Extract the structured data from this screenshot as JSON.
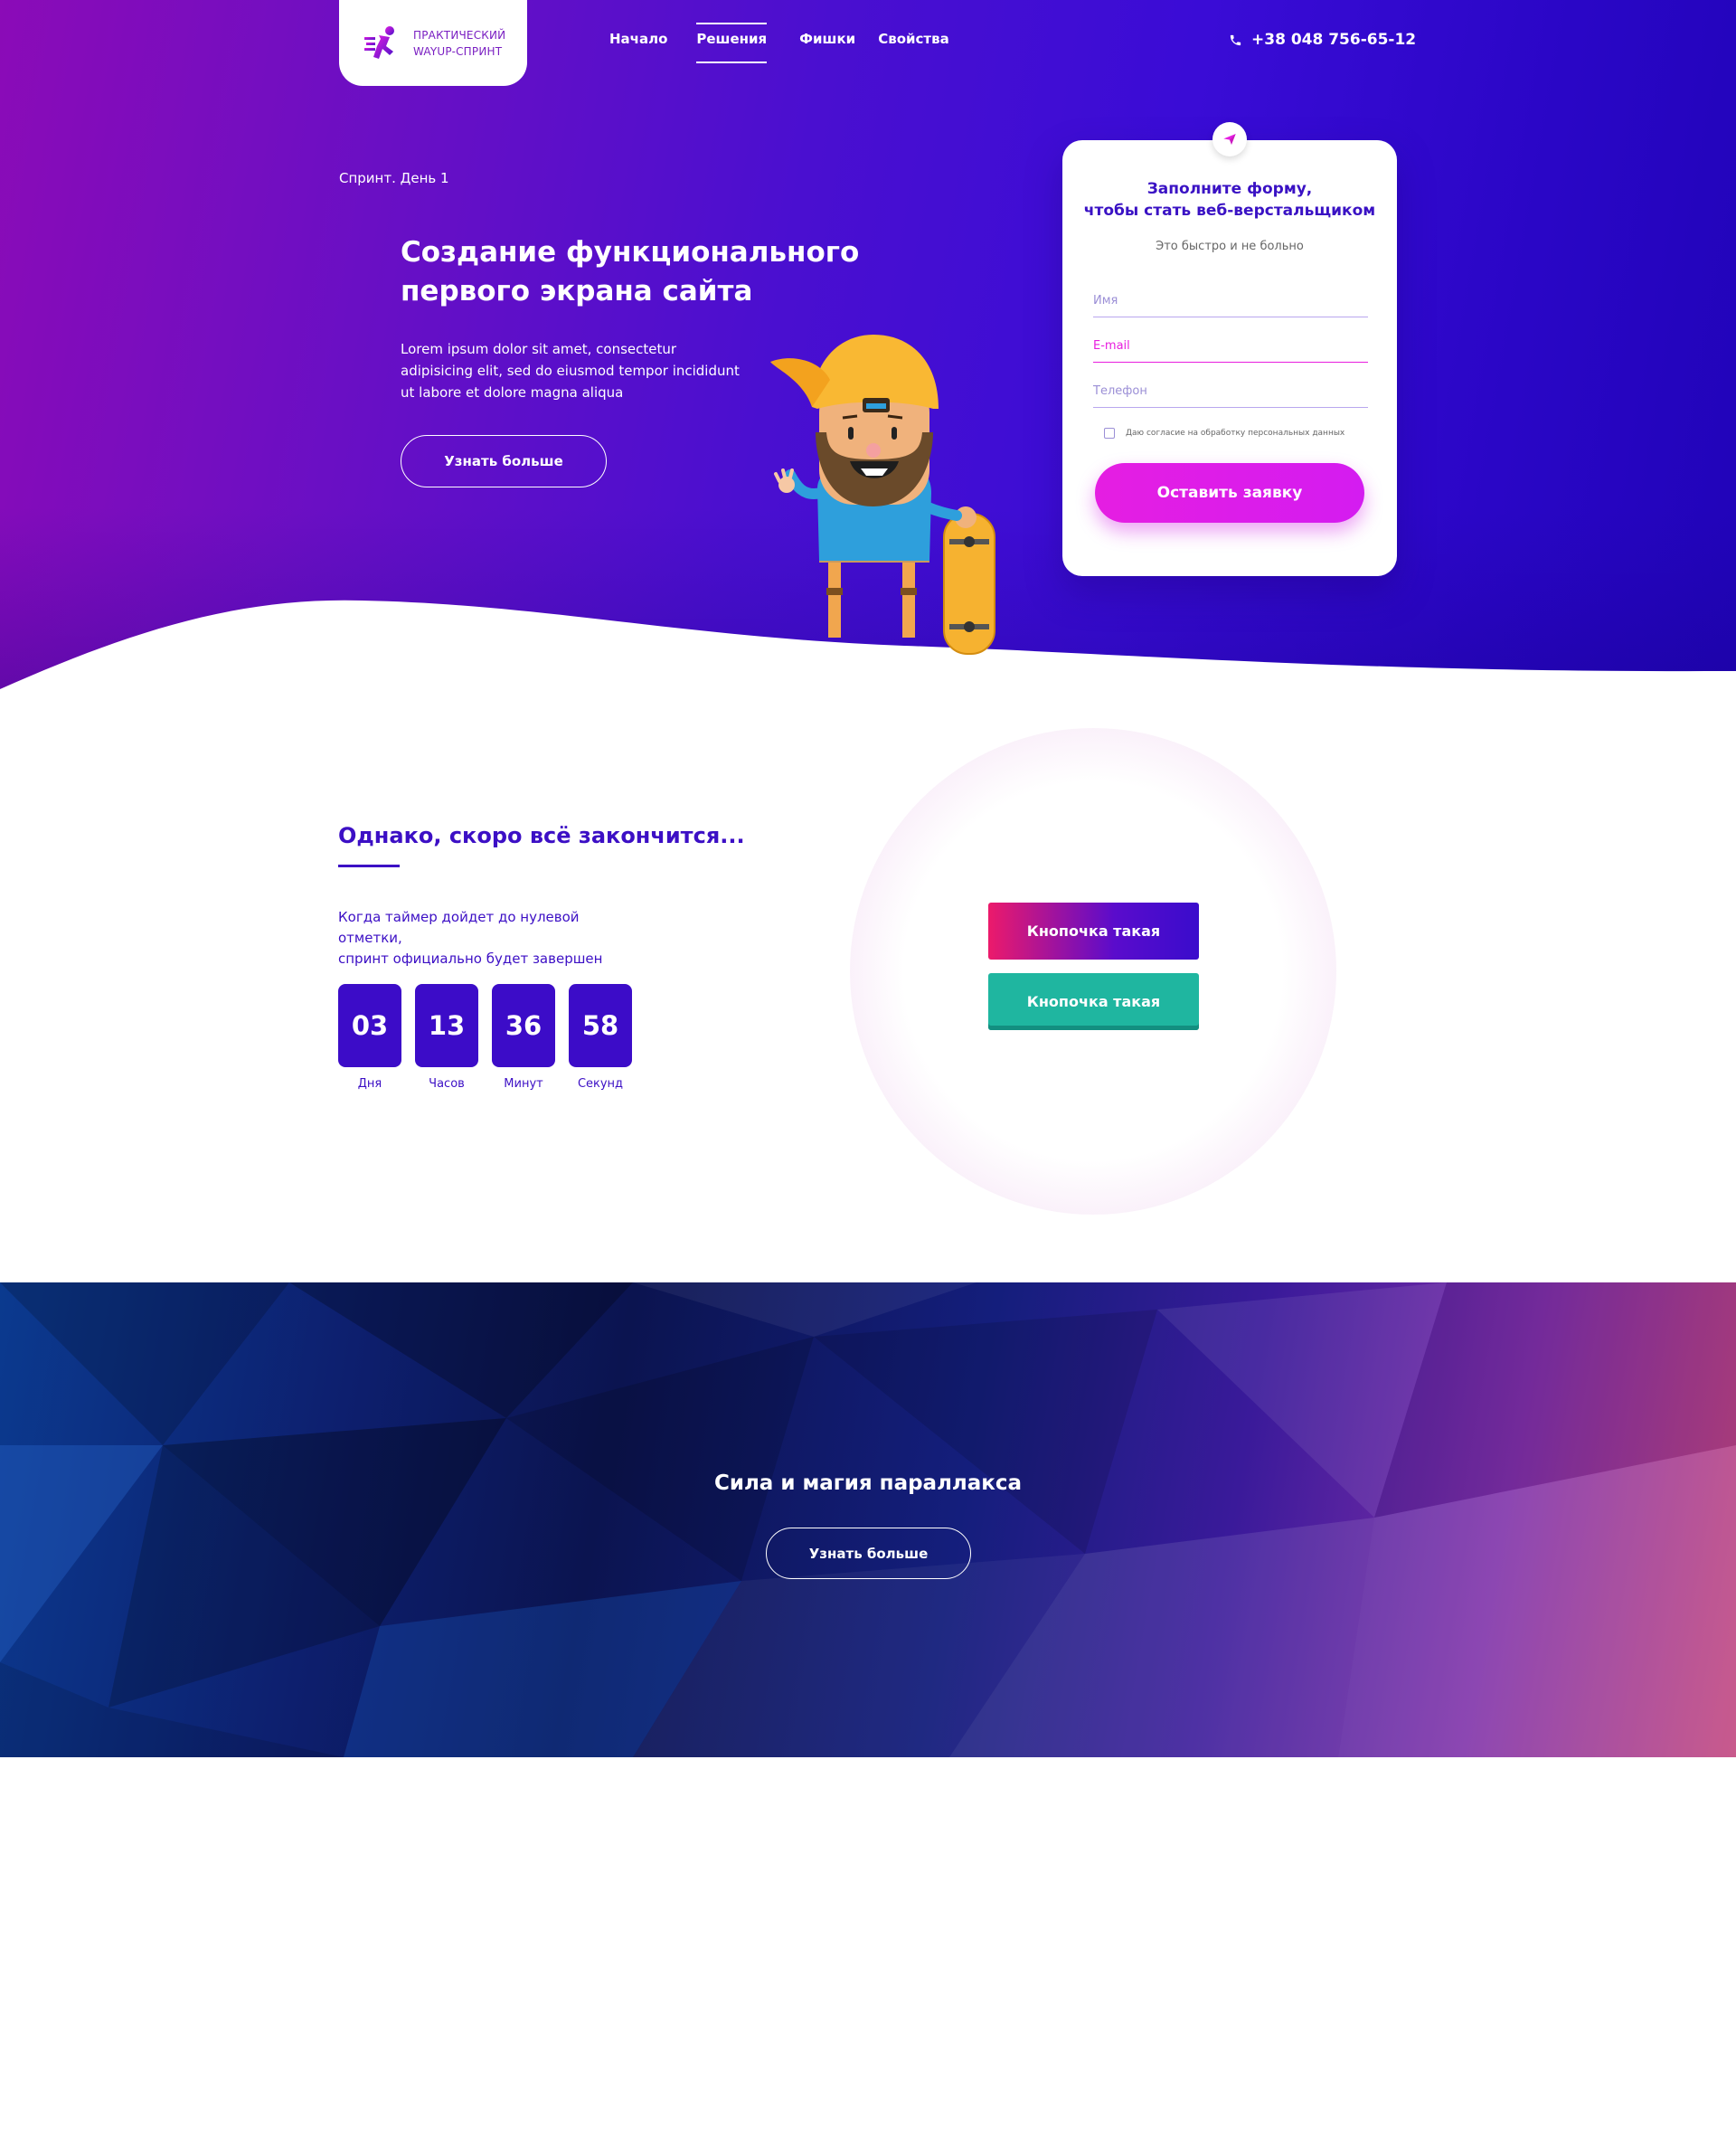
{
  "logo": {
    "line1": "ПРАКТИЧЕСКИЙ",
    "line2": "WAYUP-СПРИНТ"
  },
  "nav": [
    {
      "label": "Начало"
    },
    {
      "label": "Решения",
      "active": true
    },
    {
      "label": "Фишки"
    },
    {
      "label": "Свойства"
    }
  ],
  "phone": "+38 048 756-65-12",
  "hero": {
    "breadcrumb": "Спринт. День 1",
    "title_line1": "Создание функционального",
    "title_line2": "первого экрана сайта",
    "text": "Lorem ipsum dolor sit amet, consectetur adipisicing elit, sed do eiusmod tempor incididunt ut labore et dolore magna aliqua",
    "button": "Узнать больше"
  },
  "form": {
    "title_line1": "Заполните форму,",
    "title_line2": "чтобы стать веб-верстальщиком",
    "subtitle": "Это быстро и не больно",
    "name_placeholder": "Имя",
    "email_placeholder": "E-mail",
    "phone_placeholder": "Телефон",
    "consent": "Даю согласие на обработку персональных данных",
    "consent_checked": false,
    "submit": "Оставить заявку"
  },
  "timer": {
    "title": "Однако, скоро всё закончится...",
    "text_line1": "Когда таймер дойдет до нулевой отметки,",
    "text_line2": "спринт официально будет завершен",
    "units": [
      {
        "value": "03",
        "label": "Дня"
      },
      {
        "value": "13",
        "label": "Часов"
      },
      {
        "value": "36",
        "label": "Минут"
      },
      {
        "value": "58",
        "label": "Секунд"
      }
    ]
  },
  "demo_buttons": {
    "button1": "Кнопочка такая",
    "button2": "Кнопочка такая"
  },
  "parallax": {
    "title": "Сила и магия параллакса",
    "button": "Узнать больше"
  },
  "colors": {
    "brand_purple": "#3c0fc5",
    "accent_pink": "#e51ee2",
    "teal": "#1fb6a0",
    "hero_gradient_start": "#8b0bb7",
    "hero_gradient_end": "#2004b8"
  }
}
